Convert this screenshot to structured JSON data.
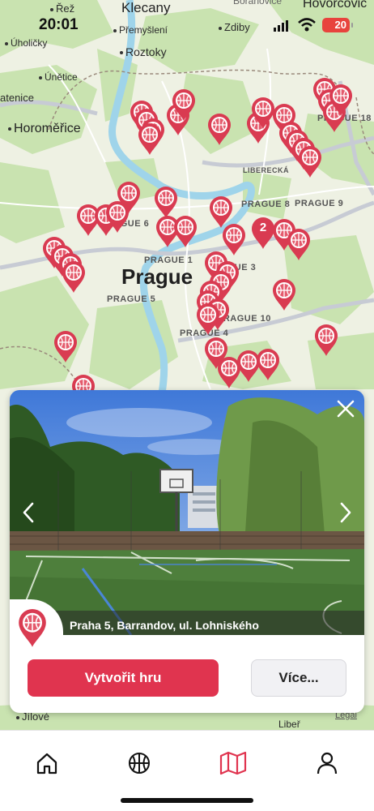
{
  "status_bar": {
    "time": "20:01",
    "battery": "20"
  },
  "map": {
    "labels": {
      "rez": "Řež",
      "klecany": "Klecany",
      "horovice": "Hovorčovic",
      "boranovice": "Bořanovice",
      "premysleni": "Přemyšlení",
      "zdiby": "Zdiby",
      "uholicky": "Úholičky",
      "roztoky": "Roztoky",
      "unetice": "Únětice",
      "atenice": "atenice",
      "horomerice": "Horoměřice",
      "prague18": "PRAGUE 18",
      "liberecka": "LIBERECKÁ",
      "prague8": "PRAGUE 8",
      "prague9": "PRAGUE 9",
      "prague6": "PRAGUE 6",
      "prague1": "PRAGUE 1",
      "prague3": "PRAGUE 3",
      "prague": "Prague",
      "prague5": "PRAGUE 5",
      "prague10": "PRAGUE 10",
      "prague4": "PRAGUE 4",
      "cluster_count": "2",
      "jilove": "Jílové",
      "libor": "Libeř",
      "legal": "Legal"
    }
  },
  "card": {
    "caption": "Praha 5, Barrandov, ul. Lohniského",
    "create_label": "Vytvořit hru",
    "more_label": "Více..."
  },
  "colors": {
    "accent": "#e0344f",
    "pin": "#d93b51"
  },
  "tabs": [
    "home-icon",
    "basketball-icon",
    "map-icon",
    "person-icon"
  ]
}
